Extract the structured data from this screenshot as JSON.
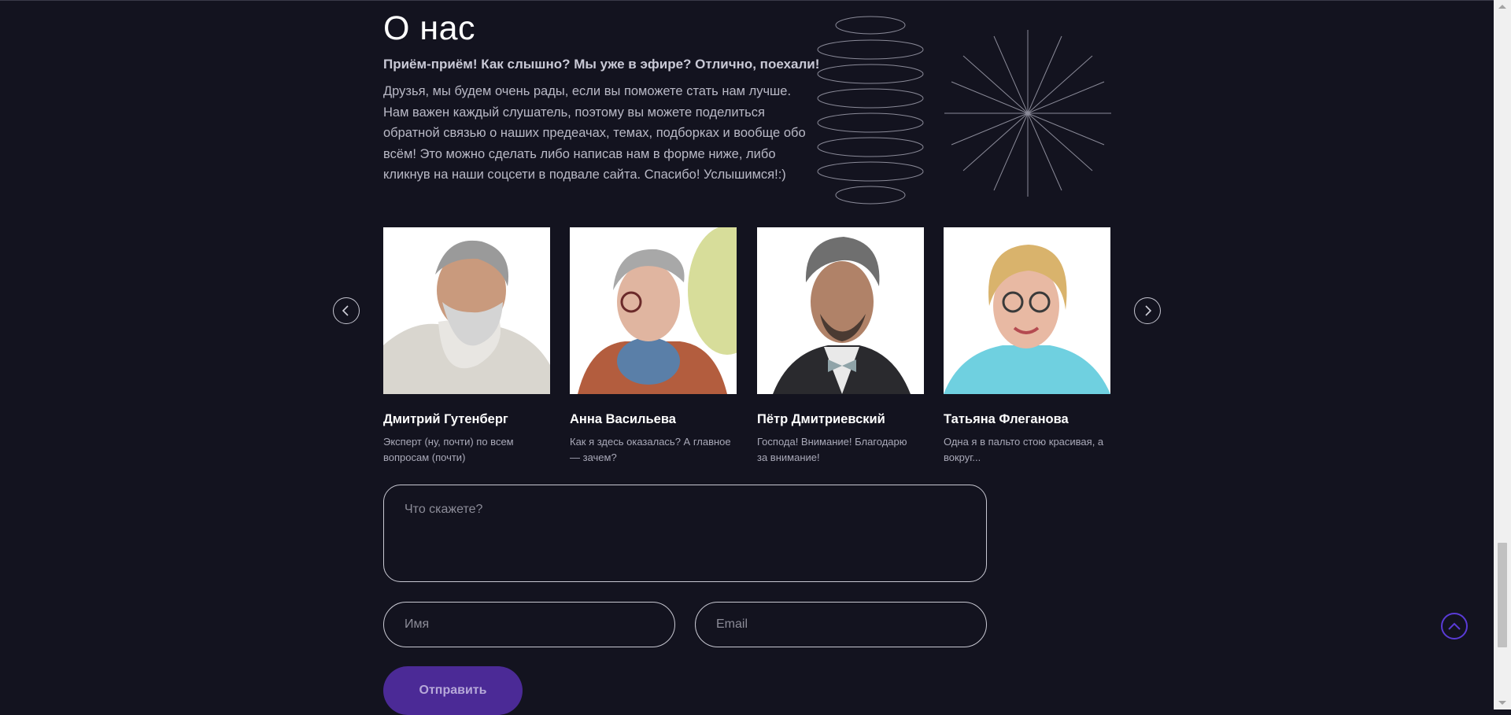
{
  "about": {
    "title": "О нас",
    "lead": "Приём-приём! Как слышно? Мы уже в эфире? Отлично, поехали!",
    "text": "Друзья, мы будем очень рады, если вы поможете стать нам лучше. Нам важен каждый слушатель, поэтому вы можете поделиться обратной связью о наших предеачах, темах, подборках и вообще обо всём! Это можно сделать либо написав нам в форме ниже, либо кликнув на наши соцсети в подвале сайта. Спасибо! Услышимся!:)"
  },
  "team": [
    {
      "name": "Дмитрий Гутенберг",
      "desc": "Эксперт (ну, почти) по всем вопросам (почти)"
    },
    {
      "name": "Анна Васильева",
      "desc": "Как я здесь оказалась? А главное — зачем?"
    },
    {
      "name": "Пётр Дмитриевский",
      "desc": "Господа! Внимание! Благодарю за внимание!"
    },
    {
      "name": "Татьяна Флеганова",
      "desc": "Одна я в пальто стою красивая, а вокруг..."
    }
  ],
  "form": {
    "message_placeholder": "Что скажете?",
    "name_placeholder": "Имя",
    "email_placeholder": "Email",
    "submit_label": "Отправить"
  },
  "icons": {
    "prev": "chevron-left-icon",
    "next": "chevron-right-icon",
    "scroll_top": "chevron-up-icon"
  },
  "colors": {
    "background": "#13131f",
    "accent": "#4b2a96",
    "scroll_top_border": "#5a3bd6"
  }
}
